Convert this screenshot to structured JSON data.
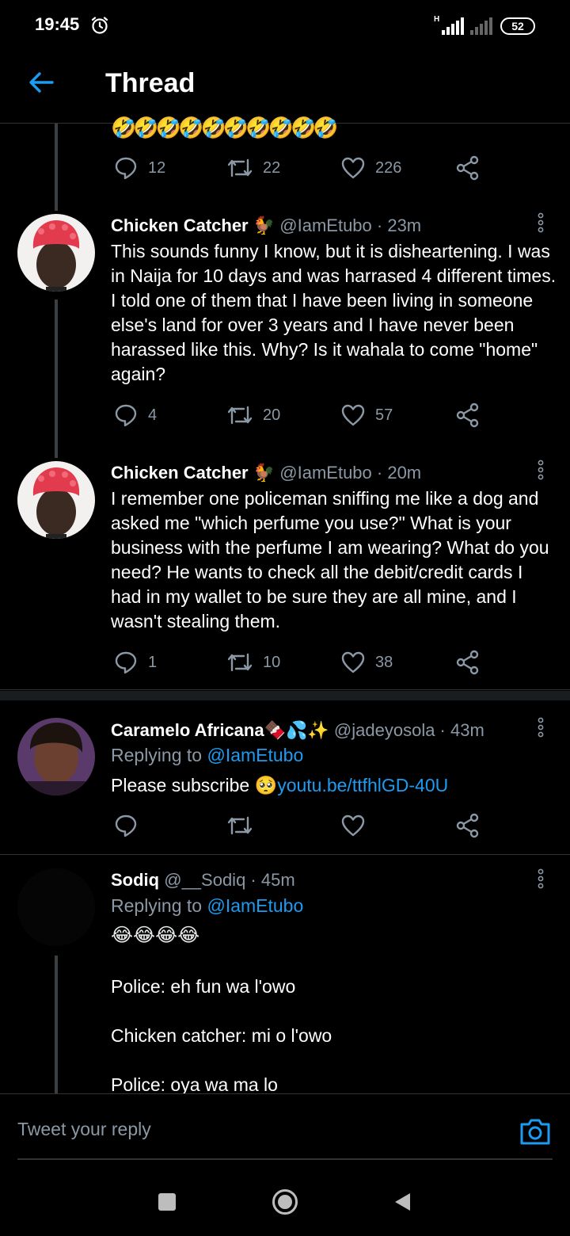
{
  "status_bar": {
    "time": "19:45",
    "battery": "52",
    "network": "H"
  },
  "header": {
    "title": "Thread"
  },
  "prev_tweet": {
    "emojis": "🤣🤣🤣🤣🤣🤣🤣🤣🤣🤣",
    "replies": "12",
    "retweets": "22",
    "likes": "226"
  },
  "tweets": [
    {
      "name": "Chicken Catcher",
      "name_emoji": "🐓",
      "handle": "@IamEtubo · 23m",
      "text": "This sounds funny I know, but it is disheartening. I was in Naija for 10 days and was harrased 4 different times. I told one of them that I have been living in someone else's land for over 3 years and I have never been harassed like this. Why? Is it wahala to come \"home\" again?",
      "replies": "4",
      "retweets": "20",
      "likes": "57"
    },
    {
      "name": "Chicken Catcher",
      "name_emoji": "🐓",
      "handle": "@IamEtubo · 20m",
      "text": "I remember one policeman sniffing me like a dog and asked me \"which perfume you use?\" What is your business with the perfume I am wearing? What do you need? He wants to check all the debit/credit cards I had in my wallet to be sure they are all mine, and I wasn't stealing them.",
      "replies": "1",
      "retweets": "10",
      "likes": "38"
    }
  ],
  "reply1": {
    "name": "Caramelo Africana",
    "name_emojis": "🍫💦✨",
    "handle": "@jadeyosola · 43m",
    "replying_prefix": "Replying to ",
    "replying_handle": "@IamEtubo",
    "text_prefix": "Please subscribe ",
    "text_emoji": "🥺",
    "link": "youtu.be/ttfhlGD-40U"
  },
  "reply2": {
    "name": "Sodiq",
    "handle": "@__Sodiq · 45m",
    "replying_prefix": "Replying to ",
    "replying_handle": "@IamEtubo",
    "emojis": "😂😂😂😂",
    "lines": [
      "Police: eh fun wa l'owo",
      "Chicken catcher: mi o l'owo",
      "Police: oya wa ma lo"
    ]
  },
  "reply_box": {
    "placeholder": "Tweet your reply"
  },
  "colors": {
    "accent": "#1d9bf0",
    "muted": "#8b98a5",
    "background": "#000000"
  }
}
